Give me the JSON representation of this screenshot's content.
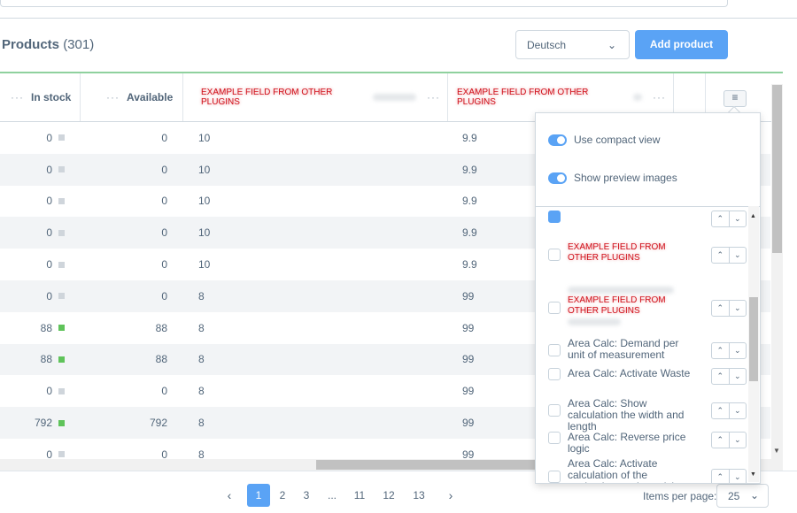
{
  "header": {
    "title": "Products",
    "count": "(301)"
  },
  "language_select": {
    "value": "Deutsch"
  },
  "add_button": {
    "label": "Add product"
  },
  "grid": {
    "columns": [
      {
        "label": "In stock"
      },
      {
        "label": "Available"
      },
      {
        "label": "EXAMPLE FIELD FROM OTHER PLUGINS"
      },
      {
        "label": "EXAMPLE FIELD FROM OTHER PLUGINS"
      }
    ],
    "rows": [
      {
        "in_stock": "0",
        "stock_status": "gray",
        "available": "0",
        "f1": "10",
        "f2": "9.9"
      },
      {
        "in_stock": "0",
        "stock_status": "gray",
        "available": "0",
        "f1": "10",
        "f2": "9.9"
      },
      {
        "in_stock": "0",
        "stock_status": "gray",
        "available": "0",
        "f1": "10",
        "f2": "9.9"
      },
      {
        "in_stock": "0",
        "stock_status": "gray",
        "available": "0",
        "f1": "10",
        "f2": "9.9"
      },
      {
        "in_stock": "0",
        "stock_status": "gray",
        "available": "0",
        "f1": "10",
        "f2": "9.9"
      },
      {
        "in_stock": "0",
        "stock_status": "gray",
        "available": "0",
        "f1": "8",
        "f2": "99"
      },
      {
        "in_stock": "88",
        "stock_status": "green",
        "available": "88",
        "f1": "8",
        "f2": "99"
      },
      {
        "in_stock": "88",
        "stock_status": "green",
        "available": "88",
        "f1": "8",
        "f2": "99"
      },
      {
        "in_stock": "0",
        "stock_status": "gray",
        "available": "0",
        "f1": "8",
        "f2": "99"
      },
      {
        "in_stock": "792",
        "stock_status": "green",
        "available": "792",
        "f1": "8",
        "f2": "99"
      },
      {
        "in_stock": "0",
        "stock_status": "gray",
        "available": "0",
        "f1": "8",
        "f2": "99"
      }
    ]
  },
  "settings_popover": {
    "toggles": [
      {
        "label": "Use compact view",
        "on": true
      },
      {
        "label": "Show preview images",
        "on": true
      }
    ],
    "columns": [
      {
        "label": "",
        "checked": true,
        "style": "normal"
      },
      {
        "label": "EXAMPLE FIELD FROM OTHER PLUGINS",
        "checked": false,
        "style": "red"
      },
      {
        "label": "EXAMPLE FIELD FROM OTHER PLUGINS",
        "checked": false,
        "style": "red-blur"
      },
      {
        "label": "Area Calc: Demand per unit of measurement",
        "checked": false,
        "style": "normal"
      },
      {
        "label": "Area Calc: Activate Waste",
        "checked": false,
        "style": "normal"
      },
      {
        "label": "Area Calc: Show calculation the width and length",
        "checked": false,
        "style": "normal"
      },
      {
        "label": "Area Calc: Reverse price logic",
        "checked": false,
        "style": "normal"
      },
      {
        "label": "Area Calc: Activate calculation of the packaging on the article",
        "checked": false,
        "style": "normal"
      }
    ]
  },
  "pagination": {
    "pages": [
      "1",
      "2",
      "3",
      "...",
      "11",
      "12",
      "13"
    ],
    "active": "1",
    "items_per_page_label": "Items per page:",
    "items_per_page": "25"
  },
  "colors": {
    "primary": "#5aa3f5",
    "stock_ok": "#5fc35a",
    "stock_none": "#cfd5db",
    "plugin_field": "#d0101a",
    "header_accent": "#8fd19e"
  },
  "icons": {
    "menu": "hamburger-icon",
    "select": "chevron-down-icon",
    "prev": "chevron-left-icon",
    "next": "chevron-right-icon"
  }
}
